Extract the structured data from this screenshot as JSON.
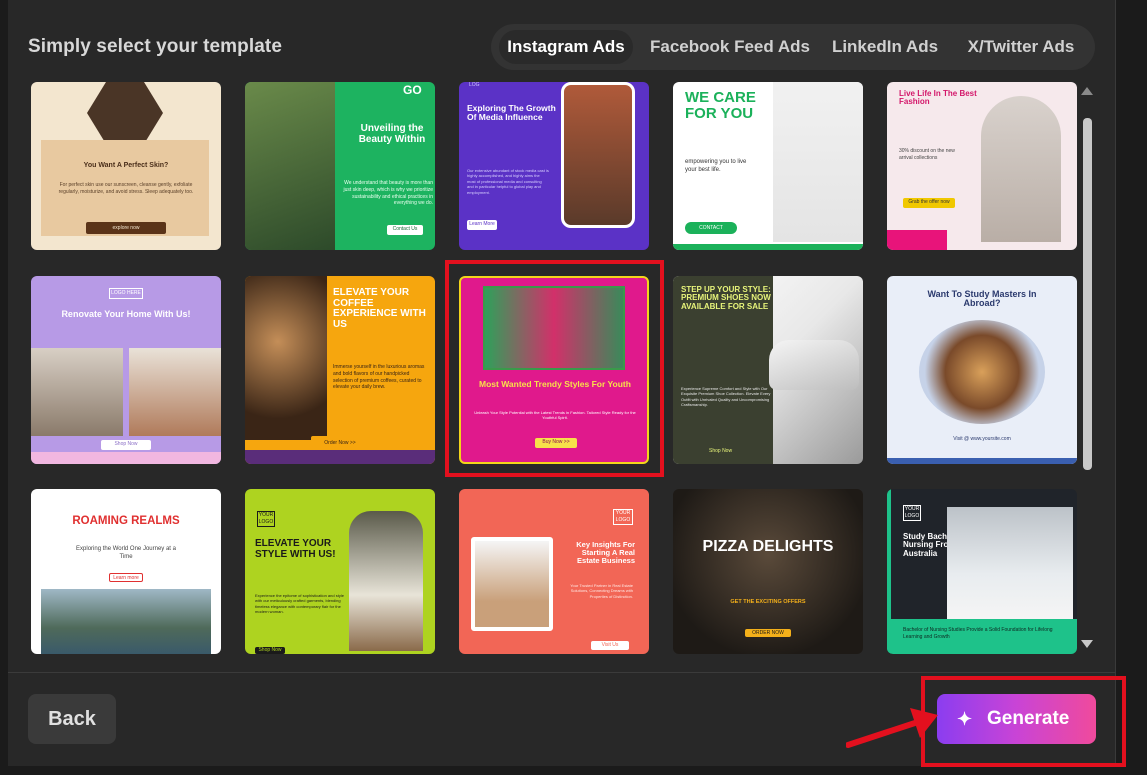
{
  "header": {
    "title": "Simply select your template"
  },
  "tabs": [
    {
      "label": "Instagram Ads",
      "active": true
    },
    {
      "label": "Facebook Feed Ads",
      "active": false
    },
    {
      "label": "LinkedIn Ads",
      "active": false
    },
    {
      "label": "X/Twitter Ads",
      "active": false
    }
  ],
  "templates": {
    "t1": {
      "title": "You Want A Perfect Skin?",
      "body": "For perfect skin use our sunscreen, cleanse gently, exfoliate regularly, moisturize, and avoid stress. Sleep adequately too.",
      "button": "explore now"
    },
    "t2": {
      "corner": "GO",
      "title": "Unveiling the Beauty Within",
      "body": "We understand that beauty is more than just skin deep, which is why we prioritize sustainability and ethical practices in everything we do.",
      "button": "Contact Us"
    },
    "t3": {
      "logo": "LOG",
      "title": "Exploring The Growth Of Media Influence",
      "body": "Our extensive abundant of stock media cast is highly accomplished, and highly aims the most of professional media and consulting and in particular helpful to global play and employment.",
      "button": "Learn More"
    },
    "t4": {
      "title": "WE CARE FOR YOU",
      "body": "empowering you to live your best life.",
      "button": "CONTACT"
    },
    "t5": {
      "title": "Live Life In The Best Fashion",
      "body": "30% discount on the new arrival collections",
      "button": "Grab the offer now"
    },
    "t6": {
      "logo": "LOGO HERE",
      "title": "Renovate Your Home With Us!",
      "button": "Shop Now"
    },
    "t7": {
      "title": "ELEVATE YOUR COFFEE EXPERIENCE WITH US",
      "body": "Immerse yourself in the luxurious aromas and bold flavors of our handpicked selection of premium coffees, curated to elevate your daily brew.",
      "button": "Order Now >>"
    },
    "t8": {
      "title": "Most Wanted Trendy Styles For Youth",
      "body": "Unleash Your Style Potential with the Latest Trends in Fashion. Tailored Style Ready for the Youthful Spirit.",
      "button": "Buy Now >>"
    },
    "t9": {
      "title": "STEP UP YOUR STYLE: PREMIUM SHOES NOW AVAILABLE FOR SALE",
      "body": "Experience Supreme Comfort and Style with Our Exquisite Premium Shoe Collection. Elevate Every Outfit with Unrivaled Quality and Uncompromising Craftsmanship.",
      "button": "Shop Now"
    },
    "t10": {
      "title": "Want To Study Masters In Abroad?",
      "footer": "Visit @ www.yoursite.com"
    },
    "t11": {
      "title": "ROAMING REALMS",
      "body": "Exploring the World One Journey at a Time",
      "button": "Learn more"
    },
    "t12": {
      "logo": "YOUR LOGO",
      "title": "ELEVATE YOUR STYLE WITH US!",
      "body": "Experience the epitome of sophistication and style with our meticulously crafted garments, blending timeless elegance with contemporary flair for the modern woman.",
      "button": "Shop Now"
    },
    "t13": {
      "logo": "YOUR LOGO",
      "title": "Key Insights For Starting A Real Estate Business",
      "body": "Your Trusted Partner in Real Estate Solutions, Connecting Dreams with Properties of Distinction.",
      "button": "Visit Us"
    },
    "t14": {
      "title": "PIZZA DELIGHTS",
      "body": "GET THE EXCITING OFFERS",
      "button": "ORDER NOW"
    },
    "t15": {
      "logo": "YOUR LOGO",
      "title": "Study Bachelor In Nursing From Australia",
      "body": "Bachelor of Nursing Studies Provide a Solid Foundation for Lifelong Learning and Growth"
    }
  },
  "footer": {
    "back_label": "Back",
    "generate_label": "Generate"
  },
  "colors": {
    "accent_gradient_start": "#8b3df0",
    "accent_gradient_end": "#f04a9c",
    "highlight_red": "#e3101e"
  }
}
